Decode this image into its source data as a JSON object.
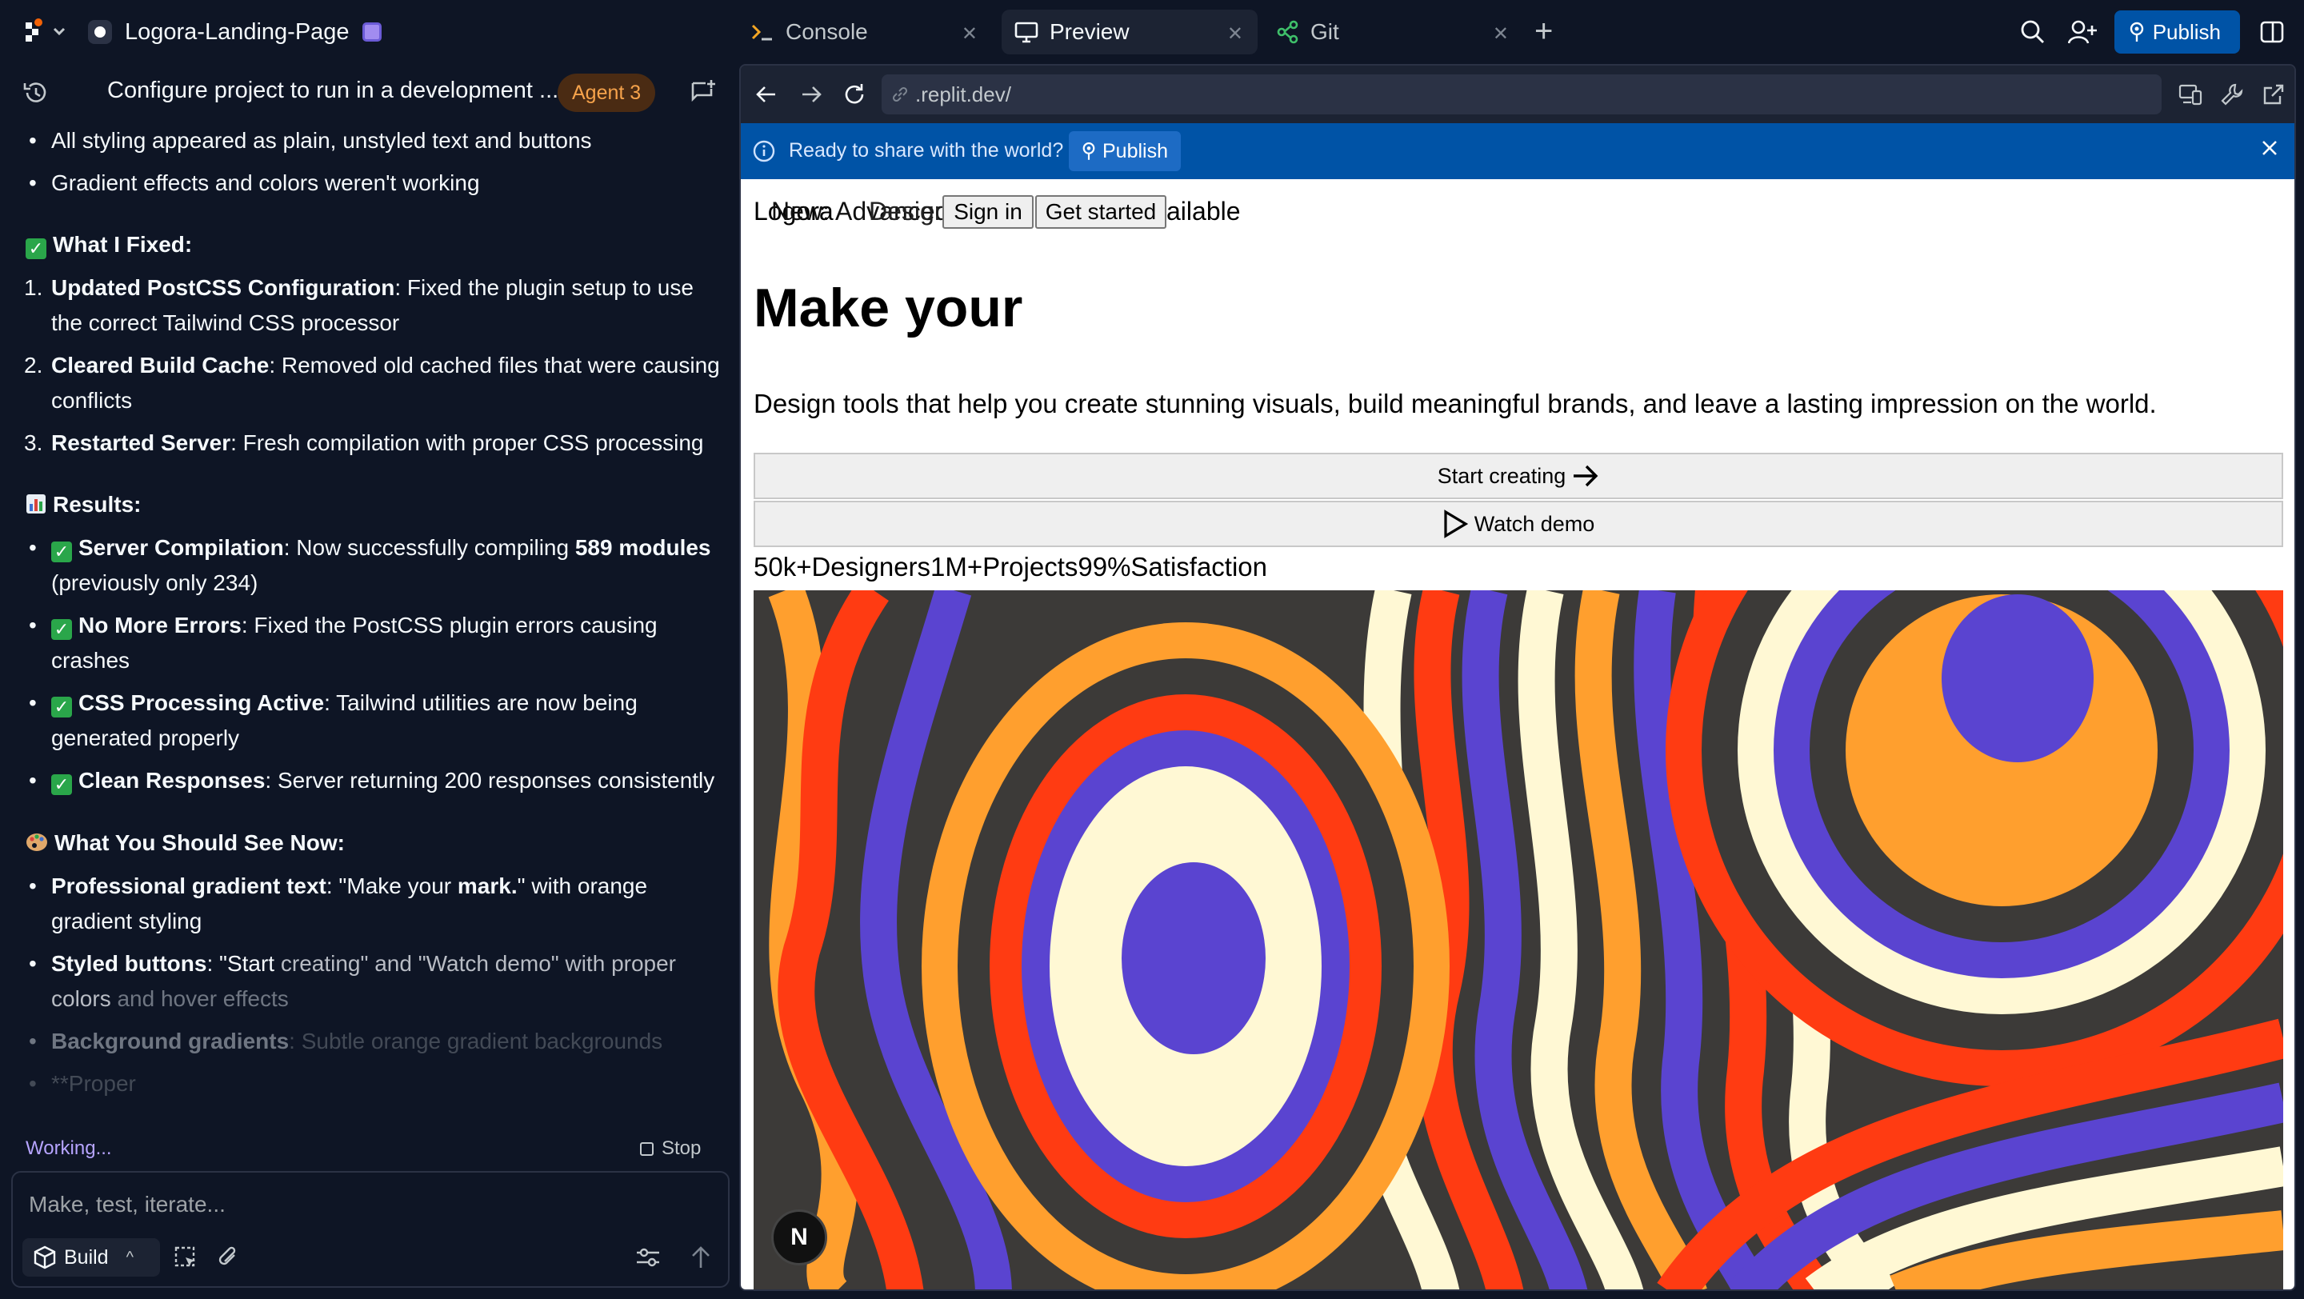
{
  "project": {
    "name": "Logora-Landing-Page"
  },
  "tabs": [
    {
      "label": "Console",
      "icon": "terminal-icon"
    },
    {
      "label": "Preview",
      "icon": "monitor-icon"
    },
    {
      "label": "Git",
      "icon": "git-branch-icon"
    }
  ],
  "top_actions": {
    "publish_label": "Publish"
  },
  "chat_header": {
    "title": "Configure project to run in a development ...",
    "badge": "Agent 3"
  },
  "chat": {
    "b1": "All styling appeared as plain, unstyled text and buttons",
    "b2": "Gradient effects and colors weren't working",
    "fixed_heading": "What I Fixed:",
    "f1_bold": "Updated PostCSS Configuration",
    "f1_rest": ": Fixed the plugin setup to use",
    "f1_cont": "the correct Tailwind CSS processor",
    "f2_bold": "Cleared Build Cache",
    "f2_rest": ": Removed old cached files that were causing",
    "f2_cont": "conflicts",
    "f3_bold": "Restarted Server",
    "f3_rest": ": Fresh compilation with proper CSS processing",
    "results_heading": "Results:",
    "r1_bold": "Server Compilation",
    "r1_rest": ": Now successfully compiling ",
    "r1_bold2": "589 modules",
    "r1_cont": "(previously only 234)",
    "r2_bold": "No More Errors",
    "r2_rest": ": Fixed the PostCSS plugin errors causing",
    "r2_cont": "crashes",
    "r3_bold": "CSS Processing Active",
    "r3_rest": ": Tailwind utilities are now being",
    "r3_cont": "generated properly",
    "r4_bold": "Clean Responses",
    "r4_rest": ": Server returning 200 responses consistently",
    "see_heading": "What You Should See Now:",
    "s1_bold": "Professional gradient text",
    "s1_rest_a": ": \"Make your ",
    "s1_bold2": "mark.",
    "s1_rest_b": "\" with orange",
    "s1_cont": "gradient styling",
    "s2_bold": "Styled buttons",
    "s2_rest_a": ": \"Start ",
    "s2_rest_b": "creating\" and \"Watch demo\" with proper",
    "s2_cont_a": "colors",
    "s2_cont_b": " and hover effects",
    "s3_bold": "Background gradients",
    "s3_rest": ": Subtle orange gradient backgrounds",
    "s4": "**Proper"
  },
  "status": {
    "working": "Working...",
    "stop": "Stop"
  },
  "composer": {
    "placeholder": "Make, test, iterate...",
    "mode": "Build"
  },
  "browser": {
    "url": ".replit.dev/"
  },
  "banner": {
    "message": "Ready to share with the world?",
    "publish": "Publish"
  },
  "site": {
    "overlap_a": "Logora",
    "overlap_b": "New: Advanced",
    "overlap_c": "Design",
    "overlap_tail": "vailable",
    "sign_in": "Sign in",
    "get_started": "Get started",
    "headline": "Make your",
    "subtitle": "Design tools that help you create stunning visuals, build meaningful brands, and leave a lasting impression on the world.",
    "cta_primary": "Start creating",
    "cta_secondary": "Watch demo",
    "stats": "50k+Designers1M+Projects99%Satisfaction",
    "dev_badge": "N"
  },
  "colors": {
    "accent_blue": "#0053a6",
    "agent_badge": "#f6a34b",
    "working": "#b6a4ff",
    "hero_red": "#ff3b12",
    "hero_orange": "#ff9f2e",
    "hero_blue": "#5a44d0",
    "hero_cream": "#fff8d4",
    "hero_dark": "#3c3a38"
  }
}
